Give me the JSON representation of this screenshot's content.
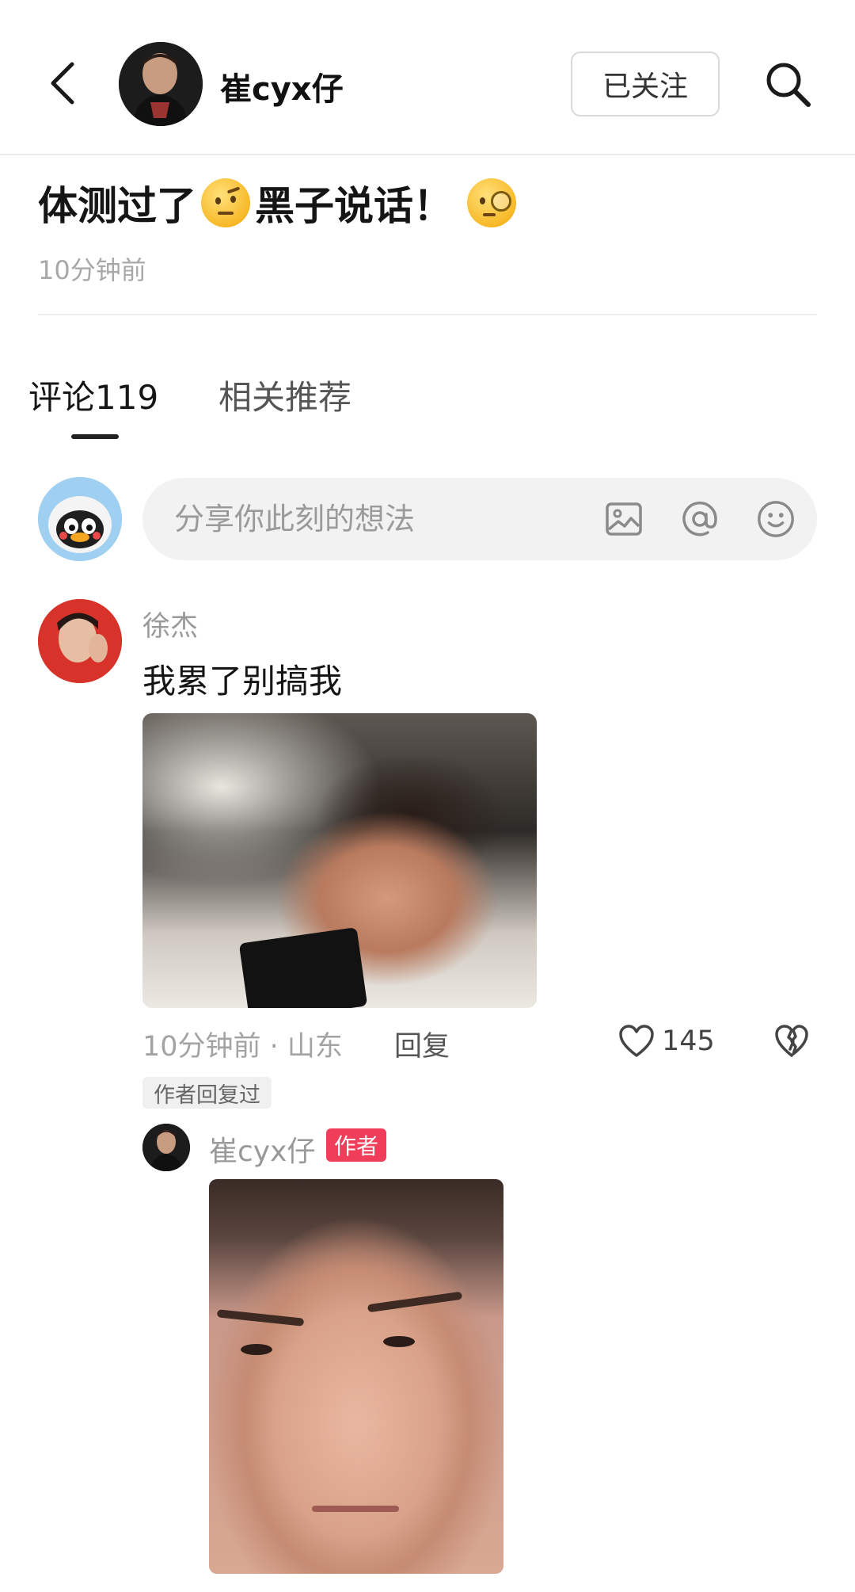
{
  "header": {
    "author_name": "崔cyx仔",
    "follow_label": "已关注"
  },
  "post": {
    "title_part1": "体测过了",
    "title_part2": "黑子说话！",
    "title_emoji_1": "raised-eyebrow-emoji",
    "title_emoji_2": "monocle-face-emoji",
    "time": "10分钟前"
  },
  "tabs": [
    {
      "label": "评论119",
      "active": true
    },
    {
      "label": "相关推荐",
      "active": false
    }
  ],
  "comment_input": {
    "placeholder": "分享你此刻的想法",
    "icons": [
      "image-icon",
      "at-icon",
      "emoji-icon"
    ]
  },
  "comment": {
    "user": "徐杰",
    "text": "我累了别搞我",
    "meta": "10分钟前 · 山东",
    "reply_label": "回复",
    "likes": "145",
    "author_replied": "作者回复过"
  },
  "reply": {
    "user": "崔cyx仔",
    "author_badge": "作者"
  },
  "colors": {
    "author_badge": "#f03e5a",
    "input_bg": "#f2f2f2"
  }
}
